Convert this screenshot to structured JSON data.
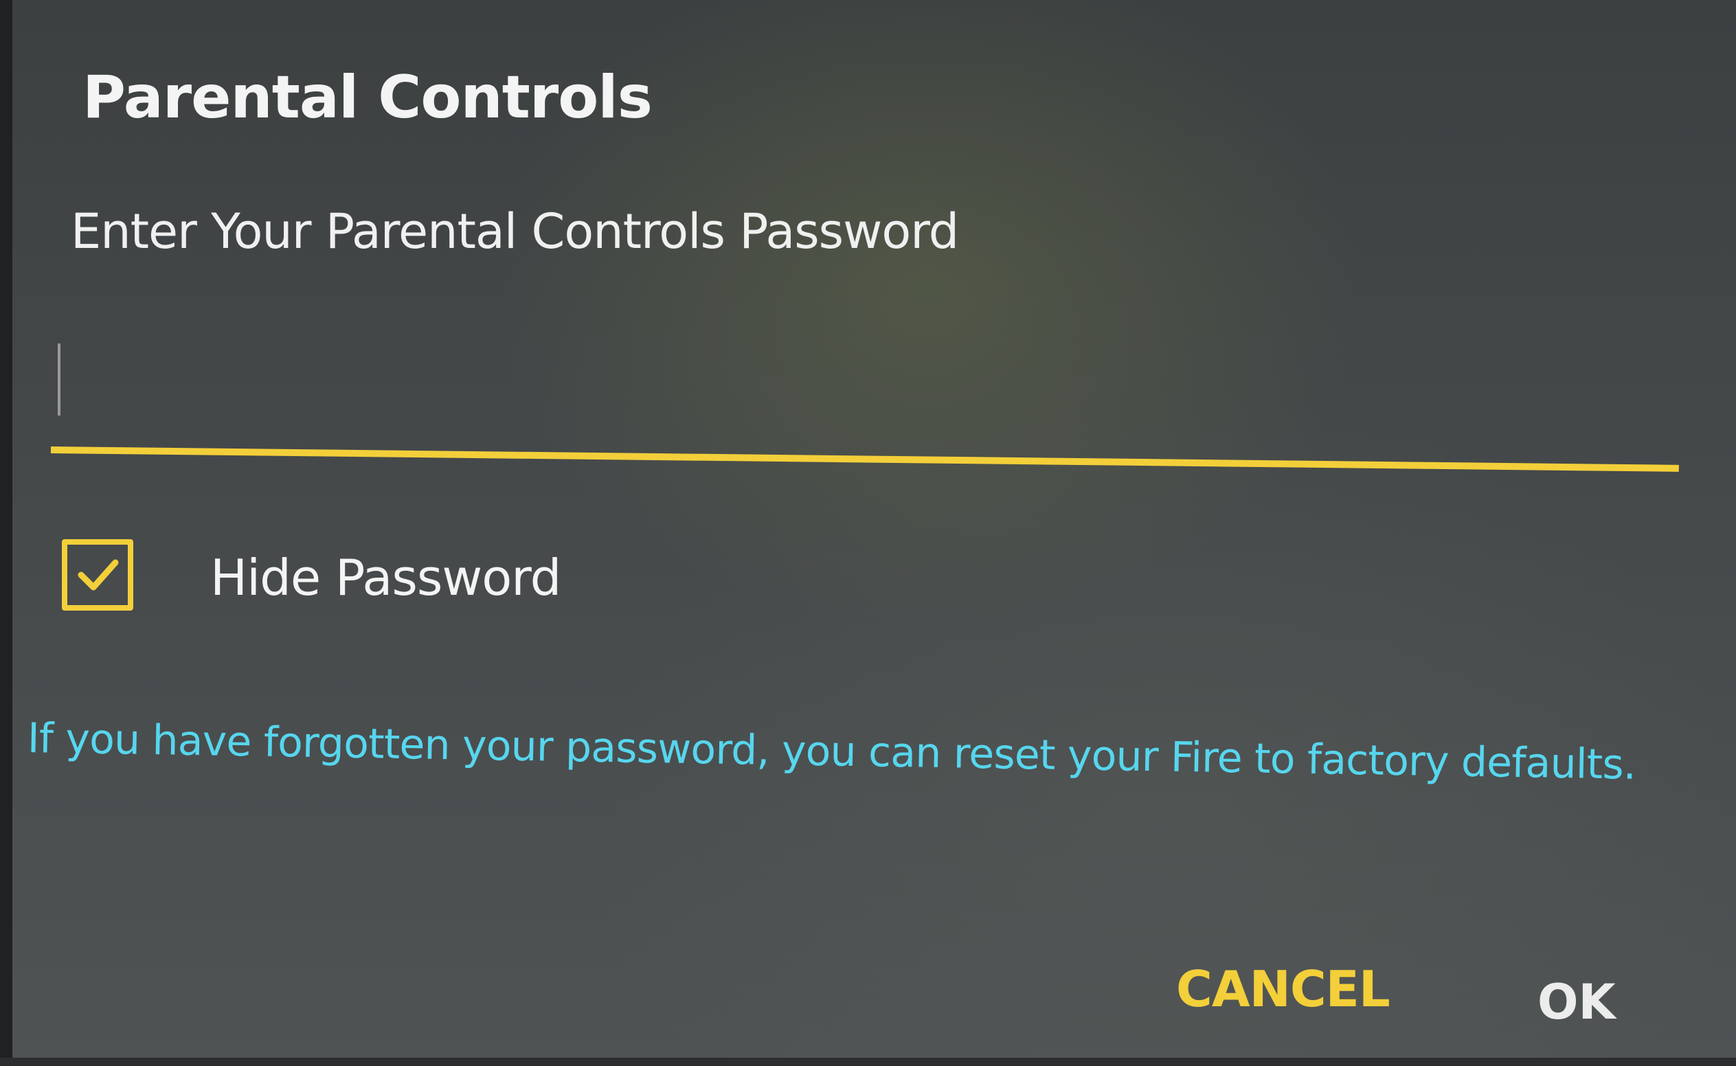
{
  "dialog": {
    "title": "Parental Controls",
    "prompt": "Enter Your Parental Controls Password",
    "password_field": {
      "value": "",
      "placeholder": ""
    },
    "hide_password": {
      "label": "Hide Password",
      "checked": true
    },
    "reset_message": "If you have forgotten your password, you can reset your Fire to factory defaults.",
    "buttons": {
      "cancel": "CANCEL",
      "ok": "OK"
    }
  },
  "colors": {
    "accent": "#f3cf3a",
    "link": "#57d6ee",
    "text": "#f4f4f4",
    "background": "#45494a"
  },
  "icons": {
    "checkbox": "checkmark-icon"
  }
}
